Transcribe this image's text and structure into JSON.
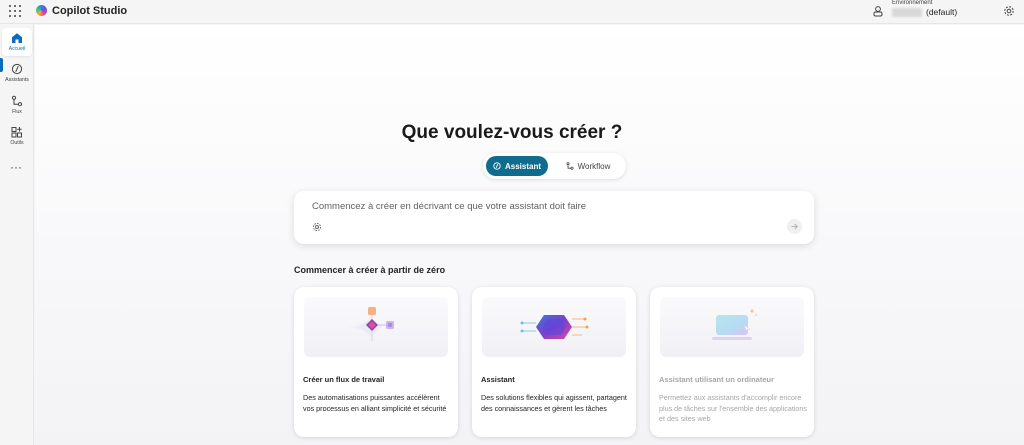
{
  "header": {
    "app_title": "Copilot Studio",
    "environment_label": "Environnement",
    "environment_name": "(default)"
  },
  "rail": {
    "items": [
      {
        "label": "Accueil",
        "icon": "home-icon",
        "active": true
      },
      {
        "label": "Assistants",
        "icon": "assistant-icon",
        "active": false
      },
      {
        "label": "Flux",
        "icon": "flow-icon",
        "active": false
      },
      {
        "label": "Outils",
        "icon": "tools-icon",
        "active": false
      }
    ],
    "more": "···"
  },
  "main": {
    "headline": "Que voulez-vous créer ?",
    "mode_toggle": {
      "options": [
        "Assistant",
        "Workflow"
      ],
      "selected": "Assistant"
    },
    "prompt": {
      "placeholder": "Commencez à créer en décrivant ce que votre assistant doit faire"
    },
    "section_title": "Commencer à créer à partir de zéro",
    "cards": [
      {
        "title": "Créer un flux de travail",
        "description": "Des automatisations puissantes accélèrent vos processus en alliant simplicité et sécurité",
        "enabled": true
      },
      {
        "title": "Assistant",
        "description": "Des solutions flexibles qui agissent, partagent des connaissances et gèrent les tâches",
        "enabled": true
      },
      {
        "title": "Assistant utilisant un ordinateur",
        "description": "Permettez aux assistants d'accomplir encore plus de tâches sur l'ensemble des applications et des sites web",
        "enabled": false
      }
    ]
  },
  "colors": {
    "accent": "#0f6c8c",
    "rail_active": "#0f6cbd"
  }
}
